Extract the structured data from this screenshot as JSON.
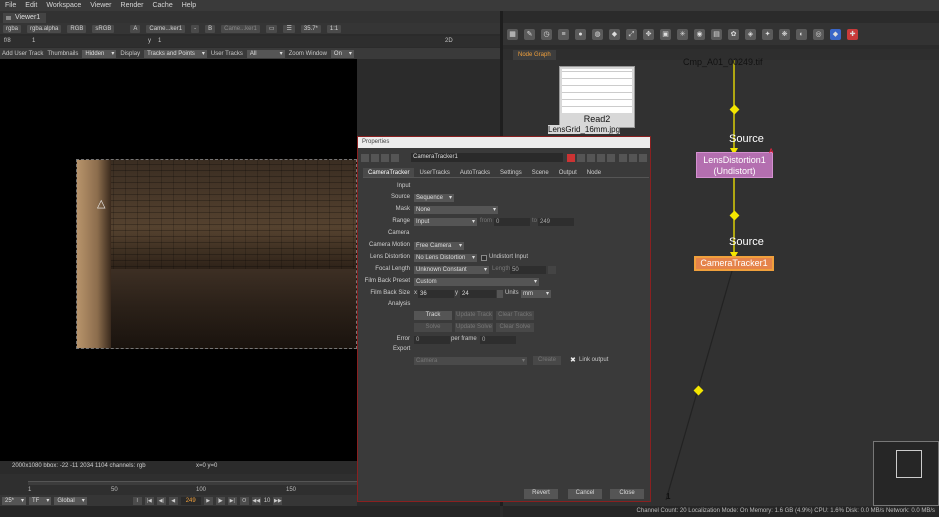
{
  "menu": [
    "File",
    "Edit",
    "Workspace",
    "Viewer",
    "Render",
    "Cache",
    "Help"
  ],
  "viewer": {
    "tab": "Viewer1",
    "channels": "rgba",
    "alpha": "rgba.alpha",
    "colorspace": "RGB",
    "lut": "sRGB",
    "input_a_label": "A",
    "input_a": "Came...ker1",
    "dash": "-",
    "input_b_label": "B",
    "input_b": "Came...ker1",
    "zoom": "35.7*",
    "ratio": "1:1",
    "mode": "2D",
    "fstop": "f/8",
    "gain": "1",
    "y_label": "y",
    "y_val": "1",
    "toolbar": {
      "add_user_track": "Add User Track",
      "thumbnails_label": "Thumbnails",
      "thumbnails": "Hidden",
      "display_label": "Display",
      "display": "Tracks and Points",
      "user_tracks_label": "User Tracks",
      "user_tracks": "All",
      "zoom_window_label": "Zoom Window",
      "zoom_window": "On"
    },
    "status": "2000x1080  bbox: -22 -11 2034 1104 channels: rgb",
    "coords": "x=0 y=0",
    "timeline": {
      "ticks": [
        "1",
        "50",
        "100",
        "150"
      ],
      "current_frame": "249",
      "fps": "25*",
      "tf": "TF",
      "scope": "Global",
      "step": "10"
    }
  },
  "node_graph": {
    "tab": "Node Graph",
    "read_node": "Read2",
    "read_file": "LensGrid_16mm.jpg",
    "top_label": "Cmp_A01_00249.tif",
    "source_label_1": "Source",
    "lens_node": "LensDistortion1",
    "lens_sub": "(Undistort)",
    "source_label_2": "Source",
    "tracker_node": "CameraTracker1",
    "bottom_input": "1",
    "status": "Channel Count: 20  Localization Mode: On  Memory: 1.6 GB (4.9%)  CPU: 1.6%  Disk: 0.0 MB/s  Network: 0.0 MB/s"
  },
  "properties": {
    "title": "Properties",
    "node_name": "CameraTracker1",
    "tabs": [
      "CameraTracker",
      "UserTracks",
      "AutoTracks",
      "Settings",
      "Scene",
      "Output",
      "Node"
    ],
    "input_group": "Input",
    "source_label": "Source",
    "source": "Sequence",
    "mask_label": "Mask",
    "mask": "None",
    "range_label": "Range",
    "range": "Input",
    "from_label": "from",
    "from_val": "0",
    "to_label": "to",
    "to_val": "249",
    "camera_group": "Camera",
    "camera_motion_label": "Camera Motion",
    "camera_motion": "Free Camera",
    "lens_distortion_label": "Lens Distortion",
    "lens_distortion": "No Lens Distortion",
    "undistort_input": "Undistort Input",
    "focal_length_label": "Focal Length",
    "focal_length": "Unknown Constant",
    "length_label": "Length",
    "length_val": "50",
    "film_back_preset_label": "Film Back Preset",
    "film_back_preset": "Custom",
    "film_back_size_label": "Film Back Size",
    "fb_x_label": "x",
    "fb_x": "36",
    "fb_y_label": "y",
    "fb_y": "24",
    "units_label": "Units",
    "units": "mm",
    "analysis_group": "Analysis",
    "track_btn": "Track",
    "update_track_btn": "Update Track",
    "clear_tracks_btn": "Clear Tracks",
    "solve_btn": "Solve",
    "update_solve_btn": "Update Solve",
    "clear_solve_btn": "Clear Solve",
    "error_label": "Error",
    "error_val": "0",
    "per_frame_label": "per frame",
    "per_frame_val": "0",
    "export_group": "Export",
    "export_select": "Camera",
    "create_btn": "Create",
    "link_output": "Link output",
    "revert_btn": "Revert",
    "cancel_btn": "Cancel",
    "close_btn": "Close"
  }
}
